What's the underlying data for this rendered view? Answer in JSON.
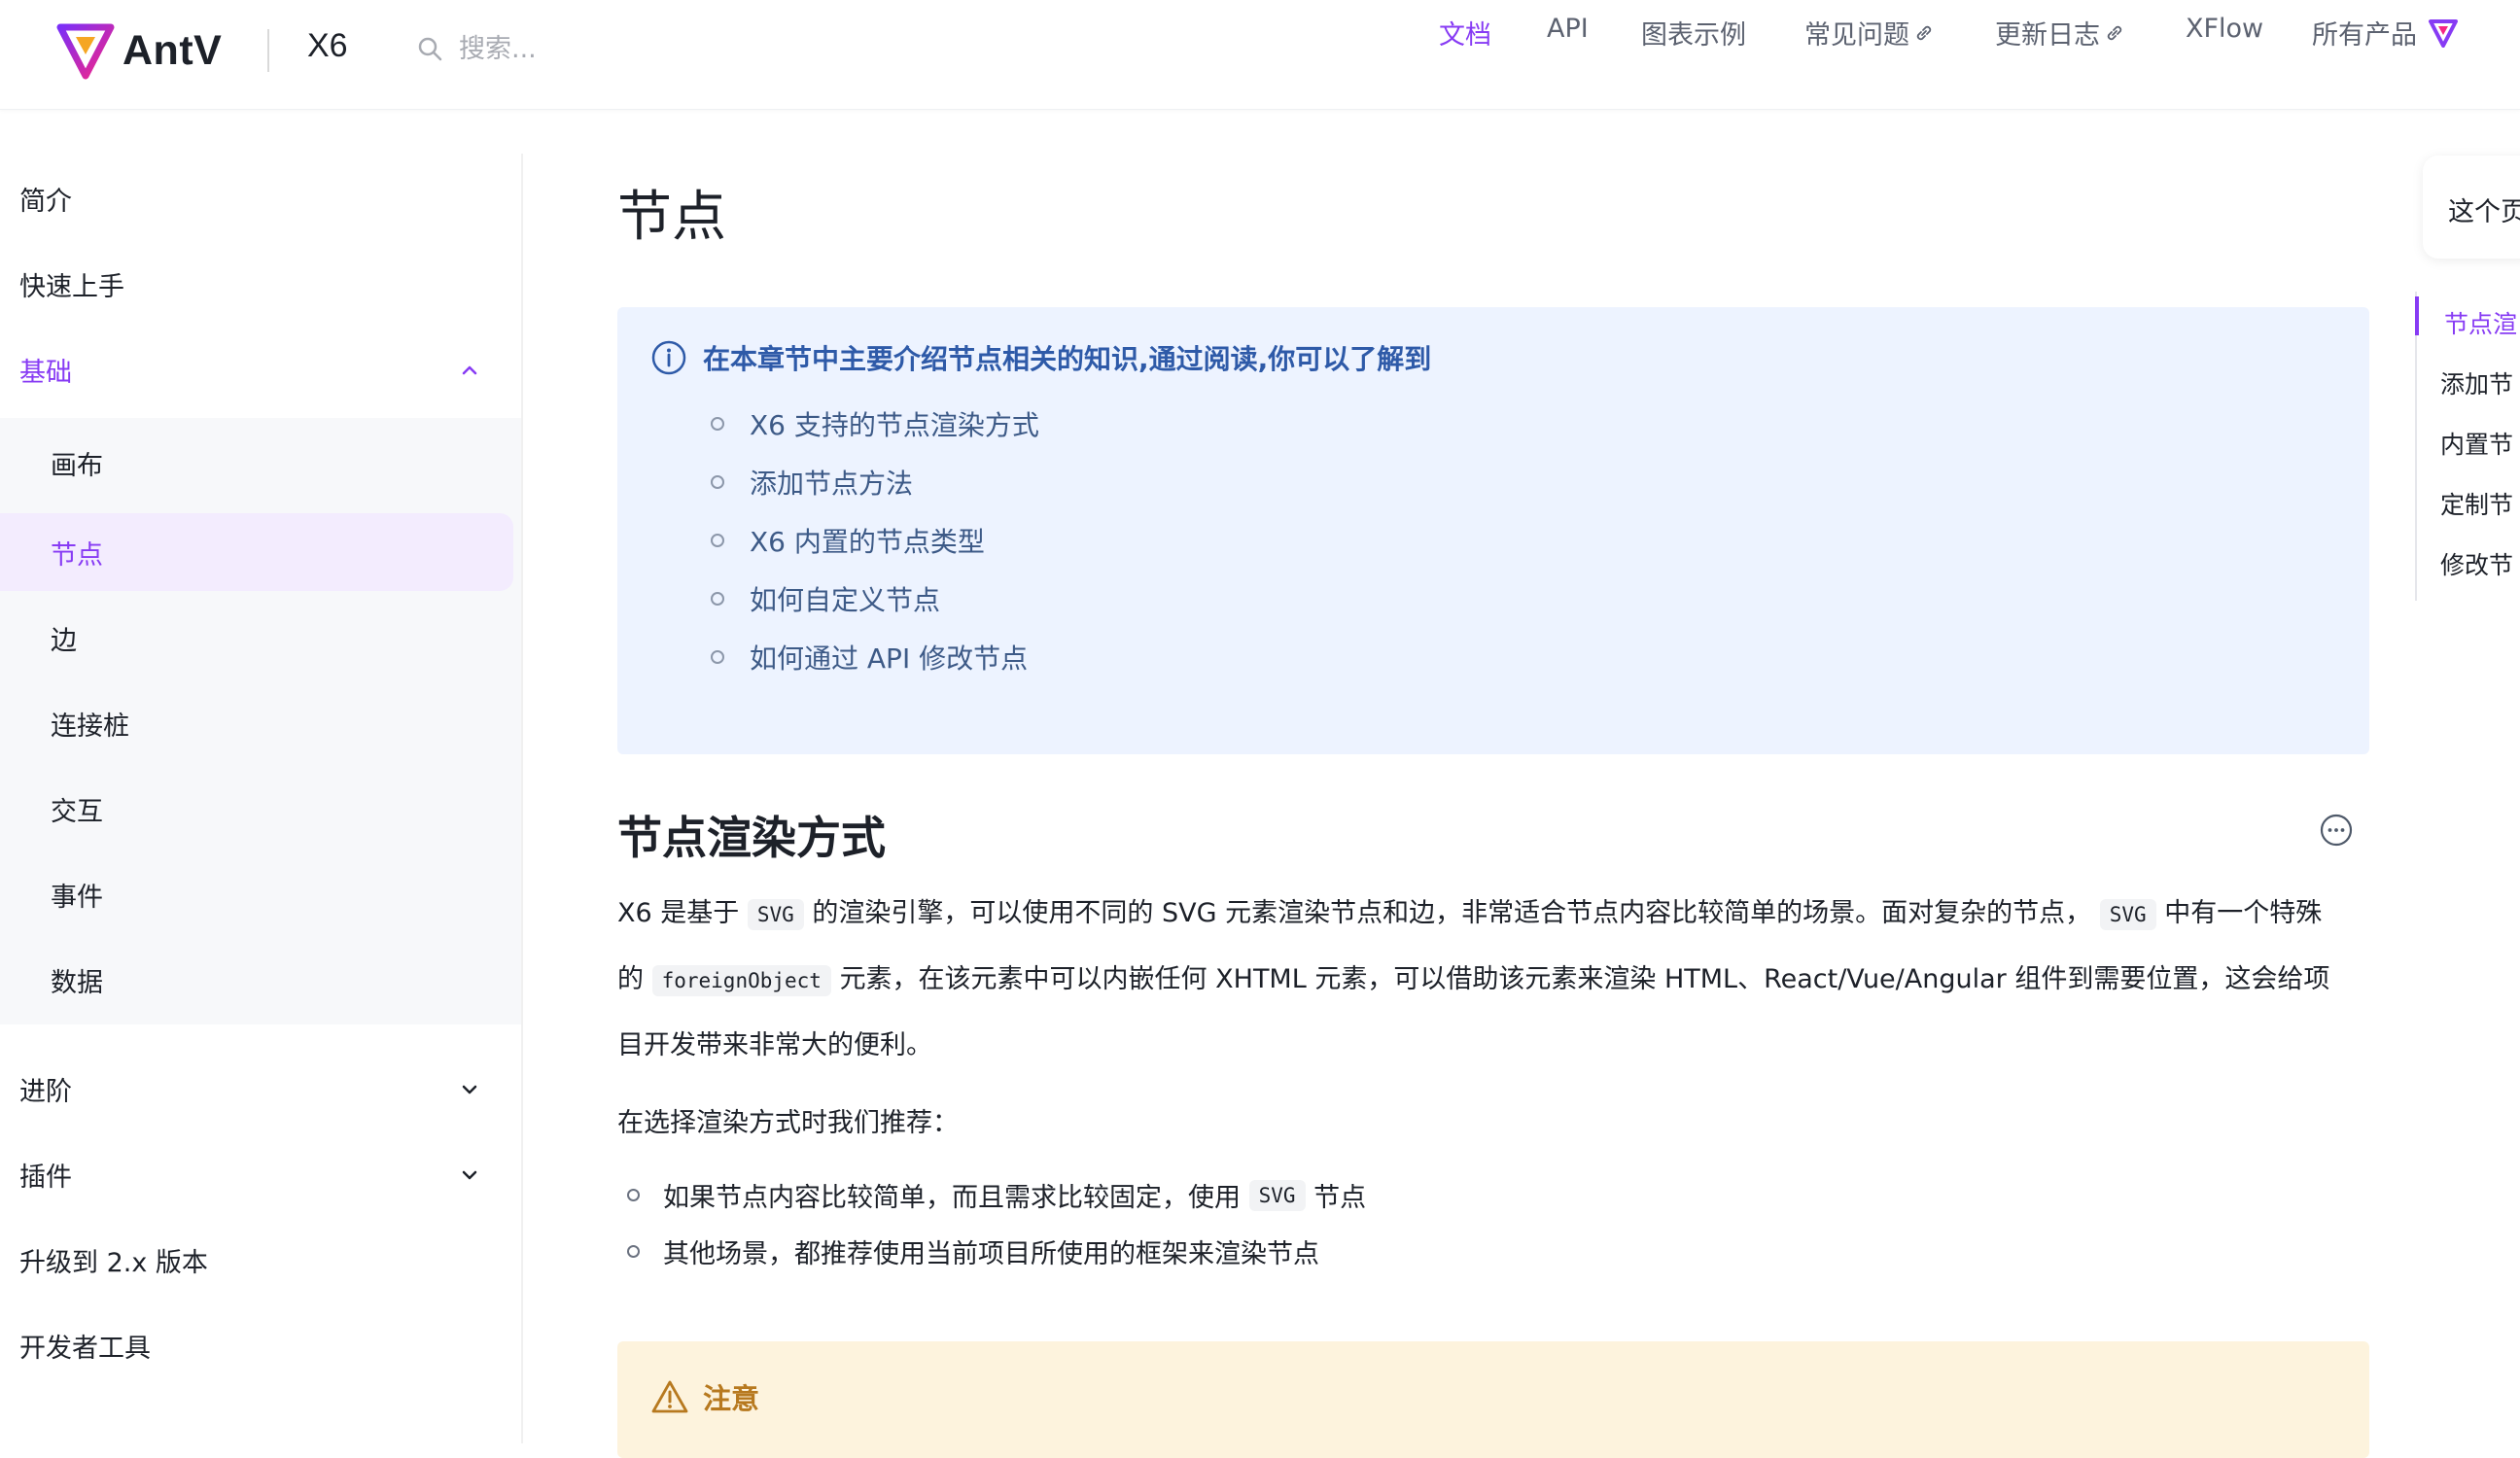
{
  "header": {
    "logo_text": "AntV",
    "product": "X6",
    "search_placeholder": "搜索...",
    "nav": [
      {
        "label": "文档",
        "active": true
      },
      {
        "label": "API"
      },
      {
        "label": "图表示例"
      },
      {
        "label": "常见问题",
        "external": true
      },
      {
        "label": "更新日志",
        "external": true
      },
      {
        "label": "XFlow"
      },
      {
        "label": "所有产品",
        "has_logo": true
      }
    ]
  },
  "sidebar": {
    "items": [
      {
        "label": "简介"
      },
      {
        "label": "快速上手"
      },
      {
        "label": "基础",
        "expanded": true
      },
      {
        "label": "画布"
      },
      {
        "label": "节点",
        "active": true
      },
      {
        "label": "边"
      },
      {
        "label": "连接桩"
      },
      {
        "label": "交互"
      },
      {
        "label": "事件"
      },
      {
        "label": "数据"
      },
      {
        "label": "进阶",
        "collapsed": true
      },
      {
        "label": "插件",
        "collapsed": true
      },
      {
        "label": "升级到 2.x 版本"
      },
      {
        "label": "开发者工具"
      }
    ]
  },
  "main": {
    "title": "节点",
    "info": {
      "title": "在本章节中主要介绍节点相关的知识,通过阅读,你可以了解到",
      "items": [
        "X6 支持的节点渲染方式",
        "添加节点方法",
        "X6 内置的节点类型",
        "如何自定义节点",
        "如何通过 API 修改节点"
      ]
    },
    "section_title": "节点渲染方式",
    "para1": {
      "a": "X6 是基于",
      "code1": "SVG",
      "b": "的渲染引擎，可以使用不同的 SVG 元素渲染节点和边，非常适合节点内容比较简单的场景。面对复杂的节点，",
      "code2": "SVG",
      "c": "中有一个特殊"
    },
    "para2": {
      "a": "的",
      "code": "foreignObject",
      "b": "元素，在该元素中可以内嵌任何 XHTML 元素，可以借助该元素来渲染 HTML、React/Vue/Angular 组件到需要位置，这会给项"
    },
    "para3": "目开发带来非常大的便利。",
    "recommend": "在选择渲染方式时我们推荐：",
    "rec_items": [
      {
        "a": "如果节点内容比较简单，而且需求比较固定，使用",
        "code": "SVG",
        "b": "节点"
      },
      {
        "a": "其他场景，都推荐使用当前项目所使用的框架来渲染节点"
      }
    ],
    "warning_title": "注意"
  },
  "toc": {
    "card_label": "这个页",
    "items": [
      "节点渲",
      "添加节",
      "内置节",
      "定制节",
      "修改节"
    ]
  },
  "colors": {
    "accent": "#873bf4",
    "info_bg": "#edf3ff",
    "info_text": "#3d5a87",
    "warn_bg": "#fdf3dd",
    "warn_text": "#b7791f"
  }
}
